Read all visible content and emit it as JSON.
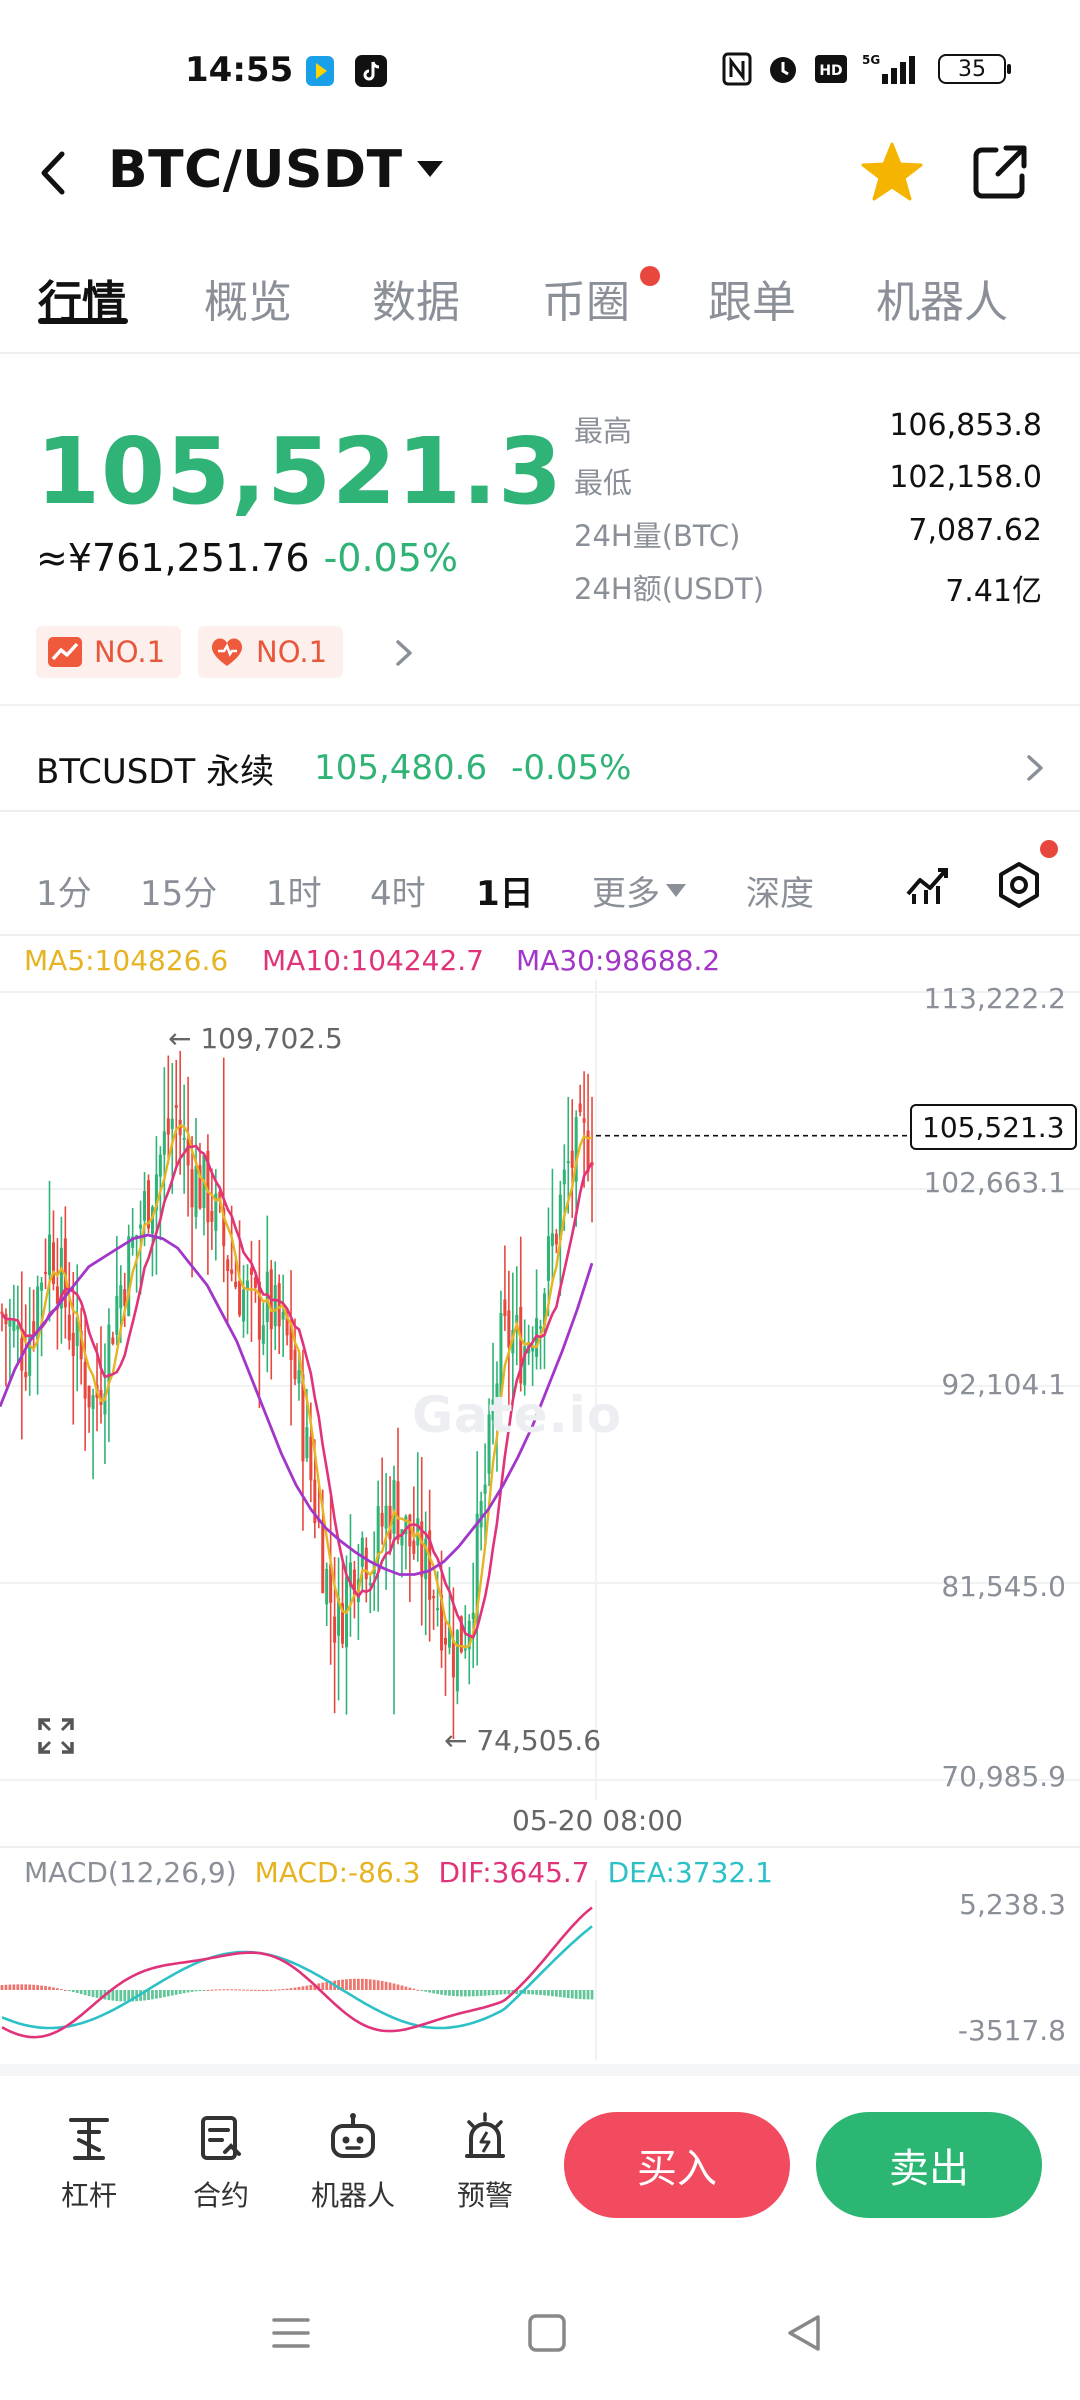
{
  "status_bar": {
    "time": "14:55",
    "battery": "35"
  },
  "header": {
    "title": "BTC/USDT"
  },
  "tabs": [
    {
      "label": "行情",
      "active": true
    },
    {
      "label": "概览"
    },
    {
      "label": "数据"
    },
    {
      "label": "币圈",
      "dot": true
    },
    {
      "label": "跟单"
    },
    {
      "label": "机器人"
    }
  ],
  "price": {
    "last": "105,521.3",
    "cny": "≈¥761,251.76",
    "change": "-0.05%"
  },
  "stats": [
    {
      "label": "最高",
      "value": "106,853.8"
    },
    {
      "label": "最低",
      "value": "102,158.0"
    },
    {
      "label": "24H量(BTC)",
      "value": "7,087.62"
    },
    {
      "label": "24H额(USDT)",
      "value": "7.41亿"
    }
  ],
  "badges": [
    {
      "label": "NO.1"
    },
    {
      "label": "NO.1"
    }
  ],
  "perpetual": {
    "name": "BTCUSDT 永续",
    "price": "105,480.6",
    "change": "-0.05%"
  },
  "intervals": [
    {
      "label": "1分"
    },
    {
      "label": "15分"
    },
    {
      "label": "1时"
    },
    {
      "label": "4时"
    },
    {
      "label": "1日",
      "active": true
    },
    {
      "label": "更多"
    },
    {
      "label": "深度"
    }
  ],
  "ma_legend": {
    "ma5": "MA5:104826.6",
    "ma10": "MA10:104242.7",
    "ma30": "MA30:98688.2"
  },
  "colors": {
    "up": "#2fb377",
    "down": "#e8473e",
    "ma5": "#e6b422",
    "ma10": "#e0337a",
    "ma30": "#a236c9",
    "dea": "#2cc1c7",
    "buy": "#f24a5e",
    "sell": "#2bb673"
  },
  "chart_data": {
    "type": "candlestick",
    "y_axis_ticks": [
      "113,222.2",
      "102,663.1",
      "92,104.1",
      "81,545.0",
      "70,985.9"
    ],
    "ylim": [
      70985.9,
      113222.2
    ],
    "current_price_label": "105,521.3",
    "current_price": 105521.3,
    "high_marker": "← 109,702.5",
    "high": 109702.5,
    "low_marker": "← 74,505.6",
    "low": 74505.6,
    "x_label": "05-20 08:00",
    "watermark": "Gate.io",
    "close_series": [
      96000,
      95000,
      94000,
      97000,
      100000,
      98000,
      95000,
      93000,
      91000,
      94000,
      97000,
      99000,
      101000,
      103000,
      105000,
      107000,
      104000,
      103000,
      102000,
      100000,
      98000,
      97000,
      96000,
      96500,
      95000,
      94000,
      90000,
      86000,
      82000,
      79000,
      82000,
      84000,
      83000,
      85000,
      86000,
      84000,
      83000,
      82000,
      80000,
      78000,
      79000,
      83000,
      88000,
      94000,
      95000,
      94000,
      96000,
      98000,
      101000,
      104000,
      104800,
      105521
    ],
    "ma30_series": [
      91000,
      93000,
      94500,
      95500,
      96500,
      97500,
      98500,
      99000,
      99500,
      100000,
      100200,
      100000,
      99500,
      98500,
      97500,
      96000,
      94500,
      92500,
      90500,
      88500,
      86800,
      85500,
      84500,
      83800,
      83200,
      82700,
      82300,
      82000,
      82000,
      82200,
      82700,
      83500,
      84500,
      85500,
      86800,
      88300,
      90000,
      92000,
      94000,
      96200,
      98688
    ],
    "macd": {
      "legend": "MACD(12,26,9)",
      "macd": "MACD:-86.3",
      "dif": "DIF:3645.7",
      "dea": "DEA:3732.1",
      "y_ticks": [
        "5,238.3",
        "-3517.8"
      ]
    }
  },
  "bottom_bar": {
    "items": [
      {
        "label": "杠杆"
      },
      {
        "label": "合约"
      },
      {
        "label": "机器人"
      },
      {
        "label": "预警"
      }
    ],
    "buy": "买入",
    "sell": "卖出"
  }
}
